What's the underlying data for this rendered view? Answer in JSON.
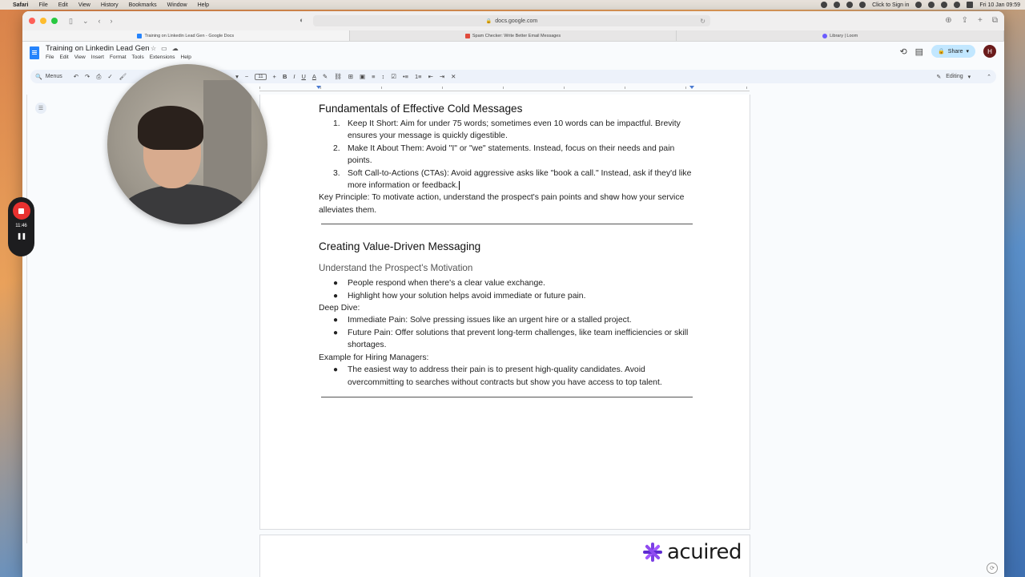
{
  "menubar": {
    "app": "Safari",
    "items": [
      "File",
      "Edit",
      "View",
      "History",
      "Bookmarks",
      "Window",
      "Help"
    ],
    "click_to_sign_in": "Click to Sign in",
    "clock": "Fri 10 Jan 09:59"
  },
  "browser": {
    "url": "docs.google.com",
    "tabs": [
      {
        "label": "Training on Linkedin Lead Gen - Google Docs",
        "color": "#2684fc"
      },
      {
        "label": "Spam Checker: Write Better Email Messages",
        "color": "#e04b3c"
      },
      {
        "label": "Library | Loom",
        "color": "#6b5cff"
      }
    ]
  },
  "docs": {
    "title": "Training on Linkedin Lead Gen",
    "menus": [
      "File",
      "Edit",
      "View",
      "Insert",
      "Format",
      "Tools",
      "Extensions",
      "Help"
    ],
    "share_label": "Share",
    "avatar_initial": "H",
    "toolbar": {
      "search_label": "Menus",
      "font_size": "11",
      "mode": "Editing",
      "bold": "B",
      "italic": "I",
      "underline": "U",
      "text_color": "A"
    }
  },
  "content": {
    "h_fundamentals": "Fundamentals of Effective Cold Messages",
    "list1": [
      {
        "num": "1.",
        "text": "Keep It Short: Aim for under 75 words; sometimes even 10 words can be impactful. Brevity ensures your message is quickly digestible."
      },
      {
        "num": "2.",
        "text": "Make It About Them: Avoid \"I\" or \"we\" statements. Instead, focus on their needs and pain points."
      },
      {
        "num": "3.",
        "text": "Soft Call-to-Actions (CTAs): Avoid aggressive asks like \"book a call.\" Instead, ask if they'd like more information or feedback."
      }
    ],
    "key_principle": "Key Principle: To motivate action, understand the prospect's pain points and show how your service alleviates them.",
    "h_value": "Creating Value-Driven Messaging",
    "h_motivation": "Understand the Prospect's Motivation",
    "bullets1": [
      "People respond when there's a clear value exchange.",
      "Highlight how your solution helps avoid immediate or future pain."
    ],
    "deep_dive": "Deep Dive:",
    "bullets2": [
      "Immediate Pain: Solve pressing issues like an urgent hire or a stalled project.",
      "Future Pain: Offer solutions that prevent long-term challenges, like team inefficiencies or skill shortages."
    ],
    "example_label": "Example for Hiring Managers:",
    "bullets3": [
      "The easiest way to address their pain is to present high-quality candidates. Avoid overcommitting to searches without contracts but show you have access to top talent."
    ]
  },
  "recording": {
    "time": "11:46"
  },
  "brand": {
    "name": "acuired"
  }
}
